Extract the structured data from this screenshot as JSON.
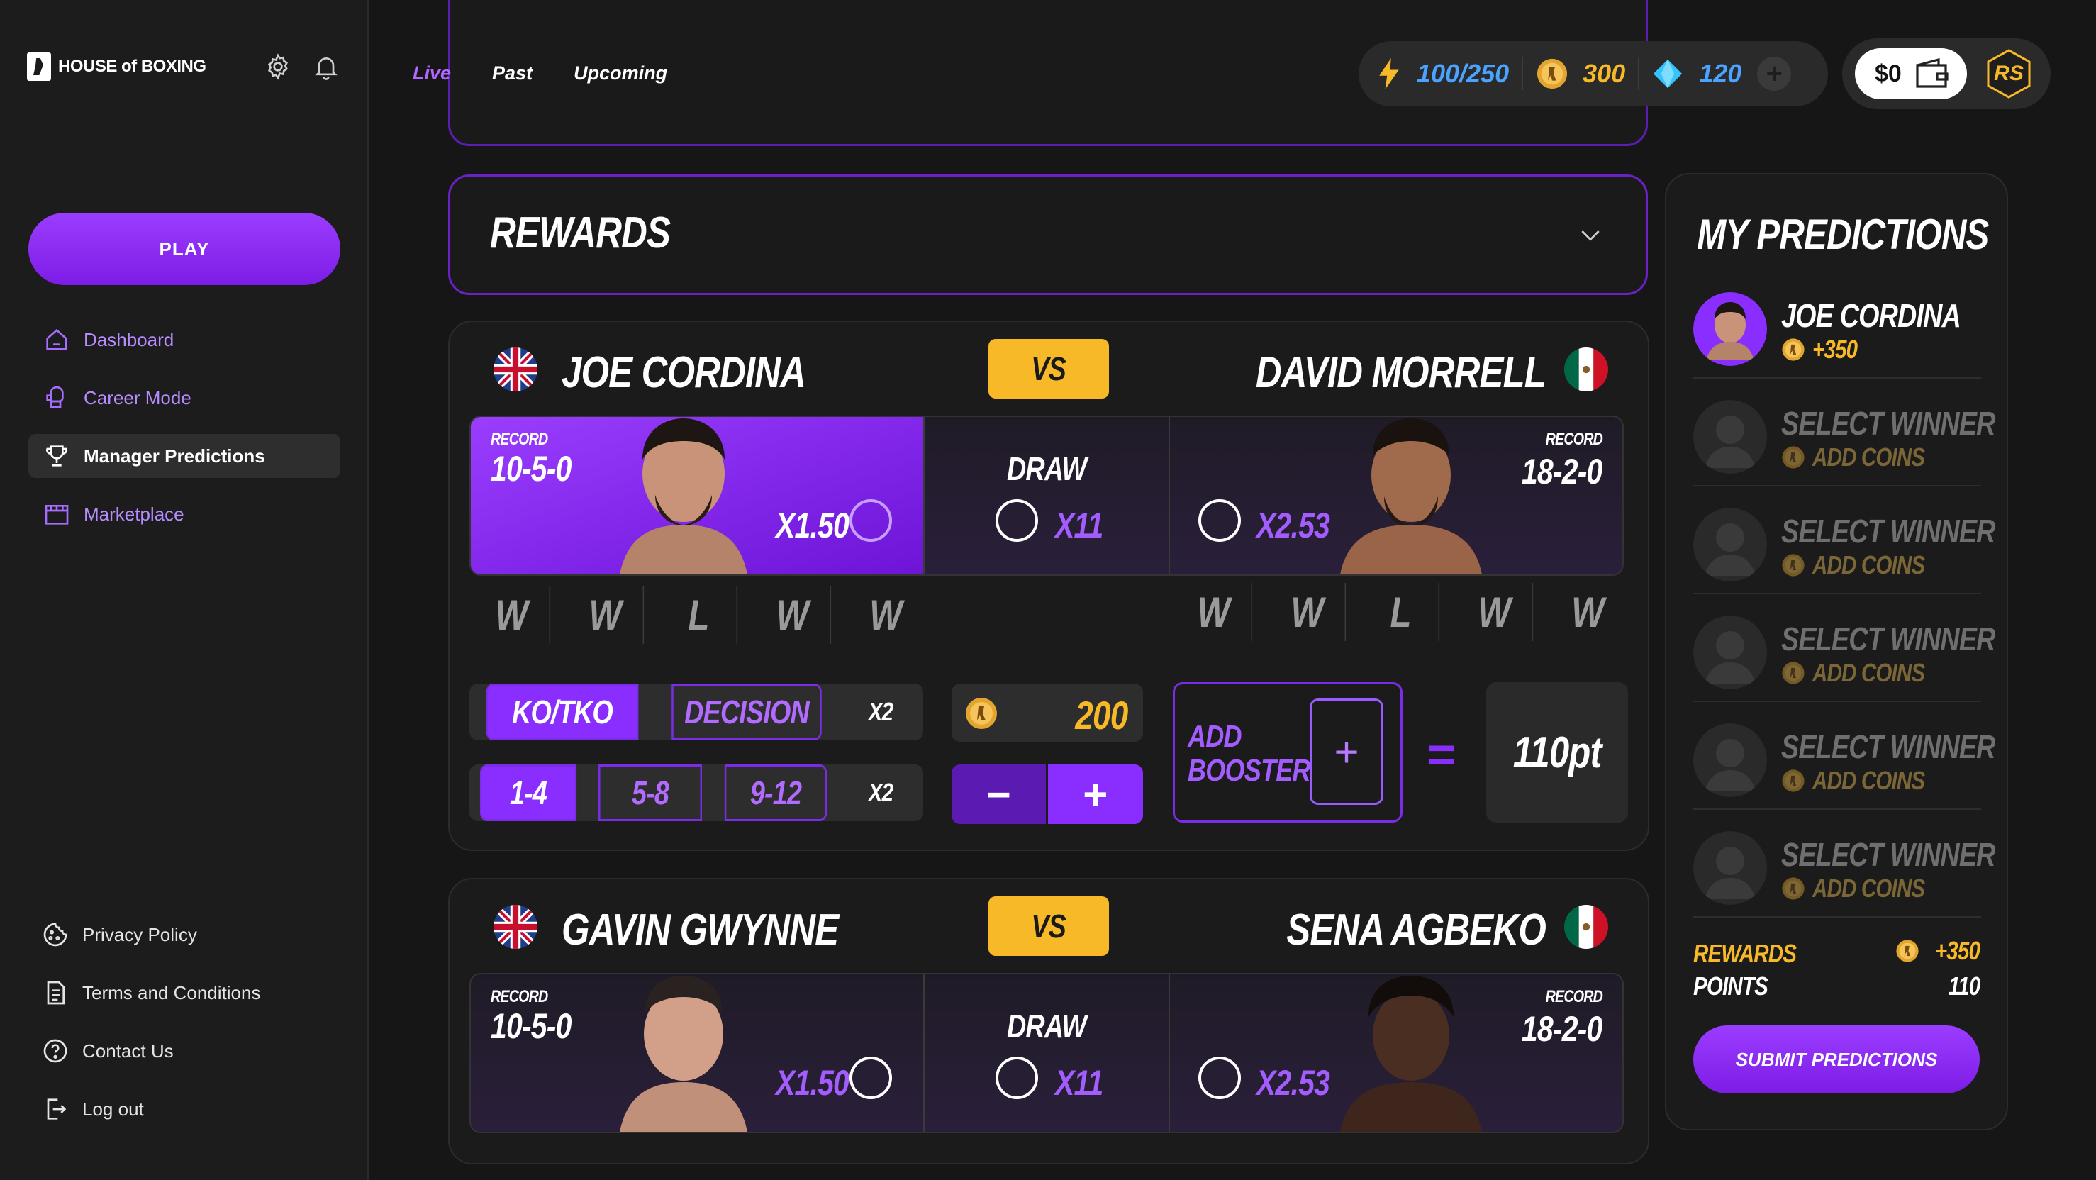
{
  "brand": {
    "name": "HOUSE of BOXING"
  },
  "sidebar": {
    "play_label": "PLAY",
    "nav": [
      {
        "label": "Dashboard",
        "icon": "home-icon"
      },
      {
        "label": "Career Mode",
        "icon": "boxing-glove-icon"
      },
      {
        "label": "Manager Predictions",
        "icon": "trophy-icon",
        "active": true
      },
      {
        "label": "Marketplace",
        "icon": "store-icon"
      }
    ],
    "footer": [
      {
        "label": "Privacy Policy",
        "icon": "cookie-icon"
      },
      {
        "label": "Terms and Conditions",
        "icon": "document-icon"
      },
      {
        "label": "Contact Us",
        "icon": "help-icon"
      },
      {
        "label": "Log out",
        "icon": "logout-icon"
      }
    ]
  },
  "header": {
    "tabs": [
      "Live",
      "Past",
      "Upcoming"
    ],
    "active_tab": "Live",
    "energy": "100/250",
    "coins": "300",
    "gems": "120",
    "wallet": "$0",
    "user_initials": "RS"
  },
  "rewards": {
    "title": "REWARDS"
  },
  "fights": [
    {
      "left": {
        "name": "JOE CORDINA",
        "flag": "uk",
        "record_label": "RECORD",
        "record": "10-5-0",
        "odds": "X1.50",
        "form": [
          "W",
          "W",
          "L",
          "W",
          "W"
        ]
      },
      "vs": "VS",
      "draw": {
        "label": "DRAW",
        "odds": "X11"
      },
      "right": {
        "name": "DAVID MORRELL",
        "flag": "mexico",
        "record_label": "RECORD",
        "record": "18-2-0",
        "odds": "X2.53",
        "form": [
          "W",
          "W",
          "L",
          "W",
          "W"
        ]
      },
      "method": {
        "options": [
          "KO/TKO",
          "DECISION"
        ],
        "selected": "KO/TKO",
        "multiplier": "X2"
      },
      "rounds": {
        "options": [
          "1-4",
          "5-8",
          "9-12"
        ],
        "selected": "1-4",
        "multiplier": "X2"
      },
      "stake": "200",
      "booster_label": "ADD BOOSTER",
      "equals": "=",
      "result": "110pt"
    },
    {
      "left": {
        "name": "GAVIN GWYNNE",
        "flag": "uk",
        "record_label": "RECORD",
        "record": "10-5-0",
        "odds": "X1.50"
      },
      "vs": "VS",
      "draw": {
        "label": "DRAW",
        "odds": "X11"
      },
      "right": {
        "name": "SENA AGBEKO",
        "flag": "mexico",
        "record_label": "RECORD",
        "record": "18-2-0",
        "odds": "X2.53"
      }
    }
  ],
  "predictions": {
    "title": "MY PREDICTIONS",
    "items": [
      {
        "name": "JOE CORDINA",
        "coins": "+350",
        "filled": true
      },
      {
        "name": "SELECT WINNER",
        "coins": "ADD COINS",
        "filled": false
      },
      {
        "name": "SELECT WINNER",
        "coins": "ADD COINS",
        "filled": false
      },
      {
        "name": "SELECT WINNER",
        "coins": "ADD COINS",
        "filled": false
      },
      {
        "name": "SELECT WINNER",
        "coins": "ADD COINS",
        "filled": false
      },
      {
        "name": "SELECT WINNER",
        "coins": "ADD COINS",
        "filled": false
      }
    ],
    "rewards_label": "REWARDS",
    "rewards_value": "+350",
    "points_label": "POINTS",
    "points_value": "110",
    "submit_label": "SUBMIT PREDICTIONS"
  },
  "colors": {
    "accent": "#8a2eff",
    "gold": "#f7b928",
    "energy": "#4aa3ff",
    "bg": "#161616"
  }
}
